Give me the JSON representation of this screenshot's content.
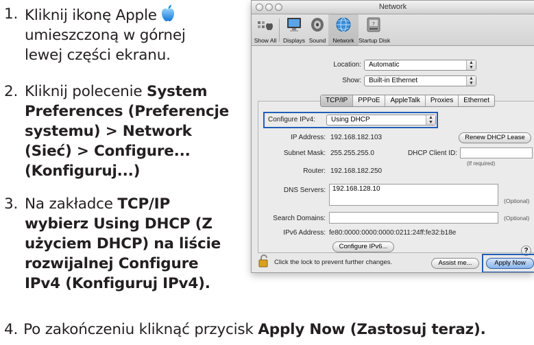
{
  "instructions": {
    "step1": {
      "num": "1.",
      "line1": "Kliknij ikonę Apple",
      "line2": "umieszczoną w górnej",
      "line3": "lewej części ekranu."
    },
    "step2": {
      "num": "2.",
      "line1": "Kliknij polecenie ",
      "line1_bold": "System",
      "line2": "Preferences (Preferencje",
      "line3": "systemu) > Network",
      "line4": "(Sieć) > Configure...",
      "line5": "(Konfiguruj...)"
    },
    "step3": {
      "num": "3.",
      "line1_plain": "Na zakładce ",
      "line1_bold": "TCP/IP",
      "line2": "wybierz Using DHCP (Z",
      "line3": "użyciem DHCP) na liście",
      "line4": "rozwijalnej Configure",
      "line5": "IPv4 (Konfiguruj IPv4)."
    },
    "step4": {
      "num": "4.",
      "plain": "Po zakończeniu kliknąć przycisk ",
      "bold": "Apply Now (Zastosuj teraz)."
    }
  },
  "window": {
    "title": "Network",
    "toolbar": [
      "Show All",
      "Displays",
      "Sound",
      "Network",
      "Startup Disk"
    ],
    "location_label": "Location:",
    "location_value": "Automatic",
    "show_label": "Show:",
    "show_value": "Built-in Ethernet",
    "tabs": [
      "TCP/IP",
      "PPPoE",
      "AppleTalk",
      "Proxies",
      "Ethernet"
    ],
    "configure_label": "Configure IPv4:",
    "configure_value": "Using DHCP",
    "ip_label": "IP Address:",
    "ip_value": "192.168.182.103",
    "renew_button": "Renew DHCP Lease",
    "subnet_label": "Subnet Mask:",
    "subnet_value": "255.255.255.0",
    "client_id_label": "DHCP Client ID:",
    "client_id_value": "",
    "if_required": "(If required)",
    "router_label": "Router:",
    "router_value": "192.168.182.250",
    "dns_label": "DNS Servers:",
    "dns_value": "192.168.128.10",
    "optional1": "(Optional)",
    "search_label": "Search Domains:",
    "search_value": "",
    "optional2": "(Optional)",
    "ipv6_label": "IPv6 Address:",
    "ipv6_value": "fe80:0000:0000:0000:0211:24ff:fe32:b18e",
    "configure_ipv6_button": "Configure IPv6...",
    "help_symbol": "?",
    "lock_text": "Click the lock to prevent further changes.",
    "assist_button": "Assist me...",
    "apply_button": "Apply Now"
  },
  "colors": {
    "highlight": "#1f5eb8",
    "apple_blue": "#1b8fe0"
  }
}
